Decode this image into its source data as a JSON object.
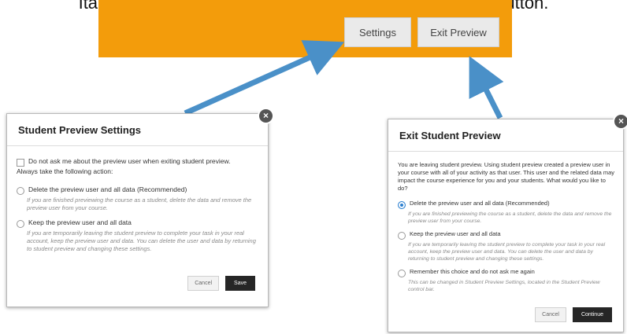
{
  "caption": "Ita. Select the option you prefer and click the continue button.",
  "topbar": {
    "settings_label": "Settings",
    "exit_preview_label": "Exit Preview"
  },
  "colors": {
    "bar": "#f39c0b",
    "arrow": "#4a90c8"
  },
  "settings_dialog": {
    "title": "Student Preview Settings",
    "close_icon": "close-icon",
    "checkbox_label": "Do not ask me about the preview user when exiting student preview.",
    "always_label": "Always take the following action:",
    "option1_title": "Delete the preview user and all data (Recommended)",
    "option1_desc": "If you are finished previewing the course as a student, delete the data and remove the preview user from your course.",
    "option2_title": "Keep the preview user and all data",
    "option2_desc": "If you are temporarily leaving the student preview to complete your task in your real account, keep the preview user and data. You can delete the user and data by returning to student preview and changing these settings.",
    "cancel_label": "Cancel",
    "save_label": "Save"
  },
  "exit_dialog": {
    "title": "Exit Student Preview",
    "close_icon": "close-icon",
    "intro": "You are leaving student preview. Using student preview created a preview user in your course with all of your activity as that user. This user and the related data may impact the course experience for you and your students. What would you like to do?",
    "option1_title": "Delete the preview user and all data (Recommended)",
    "option1_desc": "If you are finished previewing the course as a student, delete the data and remove the preview user from your course.",
    "option2_title": "Keep the preview user and all data",
    "option2_desc": "If you are temporarily leaving the student preview to complete your task in your real account, keep the preview user and data. You can delete the user and data by returning to student preview and changing these settings.",
    "option3_title": "Remember this choice and do not ask me again",
    "option3_desc": "This can be changed in Student Preview Settings, located in the Student Preview control bar.",
    "cancel_label": "Cancel",
    "continue_label": "Continue"
  }
}
